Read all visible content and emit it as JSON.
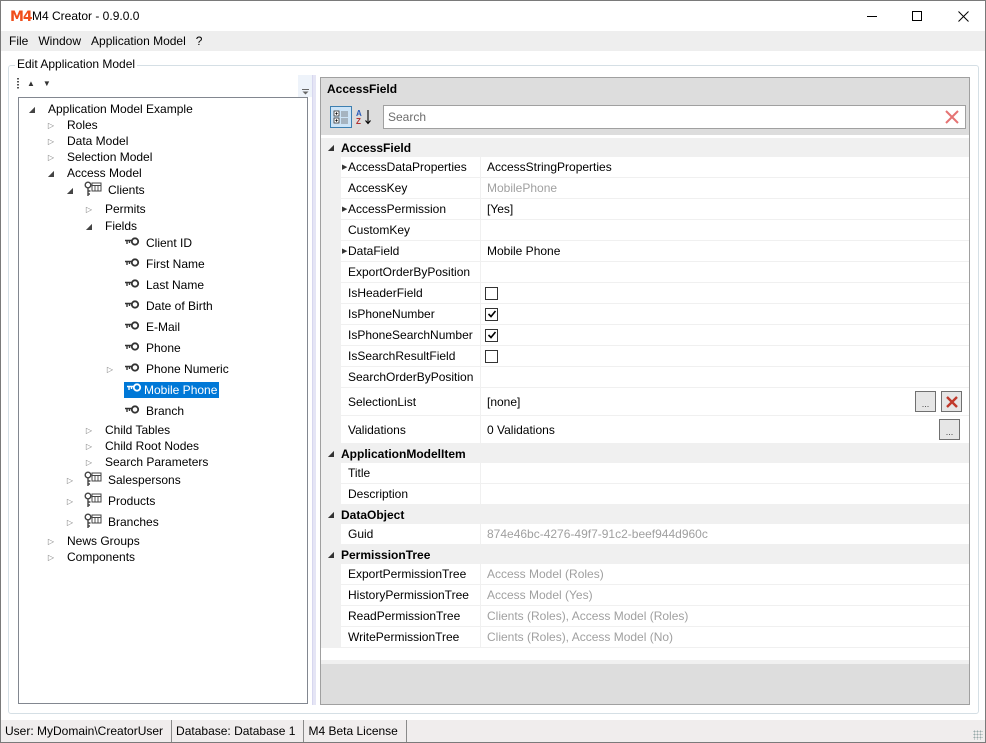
{
  "window": {
    "logo": "M4",
    "title": "M4 Creator - 0.9.0.0",
    "controls": {
      "minimize": "minimize",
      "maximize": "maximize",
      "close": "close"
    }
  },
  "menu": [
    "File",
    "Window",
    "Application Model",
    "?"
  ],
  "group_title": "Edit Application Model",
  "tree": {
    "toolbar": {
      "up_icon": "▲",
      "down_icon": "▼",
      "overflow_icon": "⯆"
    },
    "nodes": [
      {
        "label": "Application Model Example",
        "level": 0,
        "state": "open",
        "icon": "none"
      },
      {
        "label": "Roles",
        "level": 1,
        "state": "closed",
        "icon": "none"
      },
      {
        "label": "Data Model",
        "level": 1,
        "state": "closed",
        "icon": "none"
      },
      {
        "label": "Selection Model",
        "level": 1,
        "state": "closed",
        "icon": "none"
      },
      {
        "label": "Access Model",
        "level": 1,
        "state": "open",
        "icon": "none"
      },
      {
        "label": "Clients",
        "level": 2,
        "state": "open",
        "icon": "key-table"
      },
      {
        "label": "Permits",
        "level": 3,
        "state": "closed",
        "icon": "none"
      },
      {
        "label": "Fields",
        "level": 3,
        "state": "open",
        "icon": "none"
      },
      {
        "label": "Client ID",
        "level": 4,
        "state": "leaf",
        "icon": "key"
      },
      {
        "label": "First Name",
        "level": 4,
        "state": "leaf",
        "icon": "key"
      },
      {
        "label": "Last Name",
        "level": 4,
        "state": "leaf",
        "icon": "key"
      },
      {
        "label": "Date of Birth",
        "level": 4,
        "state": "leaf",
        "icon": "key"
      },
      {
        "label": "E-Mail",
        "level": 4,
        "state": "leaf",
        "icon": "key"
      },
      {
        "label": "Phone",
        "level": 4,
        "state": "leaf",
        "icon": "key"
      },
      {
        "label": "Phone Numeric",
        "level": 4,
        "state": "closed",
        "icon": "key"
      },
      {
        "label": "Mobile Phone",
        "level": 4,
        "state": "leaf",
        "icon": "key",
        "selected": true
      },
      {
        "label": "Branch",
        "level": 4,
        "state": "leaf",
        "icon": "key"
      },
      {
        "label": "Child Tables",
        "level": 3,
        "state": "closed",
        "icon": "none"
      },
      {
        "label": "Child Root Nodes",
        "level": 3,
        "state": "closed",
        "icon": "none"
      },
      {
        "label": "Search Parameters",
        "level": 3,
        "state": "closed",
        "icon": "none"
      },
      {
        "label": "Salespersons",
        "level": 2,
        "state": "closed",
        "icon": "key-table"
      },
      {
        "label": "Products",
        "level": 2,
        "state": "closed",
        "icon": "key-table"
      },
      {
        "label": "Branches",
        "level": 2,
        "state": "closed",
        "icon": "key-table"
      },
      {
        "label": "News Groups",
        "level": 1,
        "state": "closed",
        "icon": "none"
      },
      {
        "label": "Components",
        "level": 1,
        "state": "closed",
        "icon": "none"
      }
    ]
  },
  "property_grid": {
    "title": "AccessField",
    "toolbar": {
      "categorized_icon": "categorized-view",
      "alphabetical_icon": "sort-az"
    },
    "search": {
      "placeholder": "Search",
      "value": ""
    },
    "categories": [
      {
        "name": "AccessField",
        "rows": [
          {
            "name": "AccessDataProperties",
            "value": "AccessStringProperties",
            "expandable": true
          },
          {
            "name": "AccessKey",
            "value": "MobilePhone",
            "muted": true
          },
          {
            "name": "AccessPermission",
            "value": "[Yes]",
            "expandable": true
          },
          {
            "name": "CustomKey",
            "value": ""
          },
          {
            "name": "DataField",
            "value": "Mobile Phone",
            "expandable": true
          },
          {
            "name": "ExportOrderByPosition",
            "value": ""
          },
          {
            "name": "IsHeaderField",
            "checkbox": true,
            "checked": false
          },
          {
            "name": "IsPhoneNumber",
            "checkbox": true,
            "checked": true
          },
          {
            "name": "IsPhoneSearchNumber",
            "checkbox": true,
            "checked": true
          },
          {
            "name": "IsSearchResultField",
            "checkbox": true,
            "checked": false
          },
          {
            "name": "SearchOrderByPosition",
            "value": ""
          },
          {
            "name": "SelectionList",
            "value": "[none]",
            "tall": true,
            "buttons": [
              "browse",
              "delete"
            ]
          },
          {
            "name": "Validations",
            "value": "0 Validations",
            "tall": true,
            "buttons": [
              "browse"
            ]
          }
        ]
      },
      {
        "name": "ApplicationModelItem",
        "rows": [
          {
            "name": "Title",
            "value": ""
          },
          {
            "name": "Description",
            "value": ""
          }
        ]
      },
      {
        "name": "DataObject",
        "rows": [
          {
            "name": "Guid",
            "value": "874e46bc-4276-49f7-91c2-beef944d960c",
            "muted": true
          }
        ]
      },
      {
        "name": "PermissionTree",
        "rows": [
          {
            "name": "ExportPermissionTree",
            "value": "Access Model (Roles)",
            "muted": true
          },
          {
            "name": "HistoryPermissionTree",
            "value": "Access Model (Yes)",
            "muted": true
          },
          {
            "name": "ReadPermissionTree",
            "value": "Clients (Roles), Access Model (Roles)",
            "muted": true
          },
          {
            "name": "WritePermissionTree",
            "value": "Clients (Roles), Access Model (No)",
            "muted": true
          }
        ]
      }
    ],
    "browse_label": "...",
    "colors": {
      "delete": "#c0392b",
      "search_clear": "#e57373",
      "selection": "#0078d7",
      "logo": "#f04e1b"
    }
  },
  "statusbar": {
    "user": "User: MyDomain\\CreatorUser",
    "database": "Database: Database 1",
    "license": "M4 Beta License"
  }
}
